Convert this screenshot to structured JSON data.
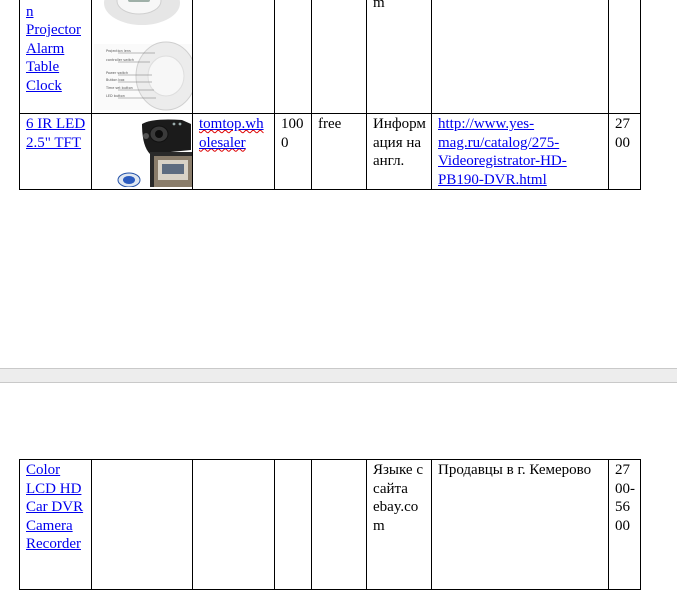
{
  "rows_top": [
    {
      "name": "Projection Projector Alarm Table Clock",
      "name_visible": "Projection Projector Alarm Table Clock",
      "extra": "m",
      "right": "."
    },
    {
      "name": "6 IR LED 2.5\" TFT",
      "seller": "tomtop.wholesaler",
      "price": "1000",
      "delivery": "free",
      "info": "Информация на англ.",
      "link": "http://www.yes-mag.ru/catalog/275-Videoregistrator-HD-PB190-DVR.html",
      "cost": "2700"
    }
  ],
  "rows_bottom": [
    {
      "name": "Color LCD HD Car DVR Camera Recorder",
      "info": "Языке с сайта ebay.com",
      "sellers_note": "Продавцы в г. Кемерово",
      "cost": "2700-5600"
    }
  ],
  "image_labels": [
    "Projection lens",
    "controller switch",
    "Power switch",
    "Button box",
    "Time set button",
    "LED button"
  ]
}
